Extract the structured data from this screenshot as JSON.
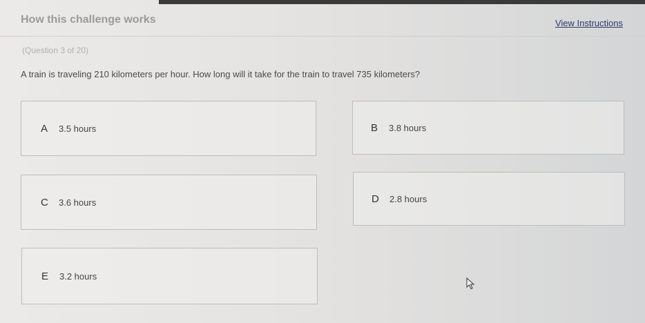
{
  "header": {
    "title": "How this challenge works",
    "view_instructions": "View Instructions"
  },
  "question": {
    "counter": "(Question 3 of 20)",
    "text": "A train is traveling 210 kilometers per hour. How long will it take for the train to travel 735 kilometers?"
  },
  "options": [
    {
      "letter": "A",
      "text": "3.5 hours"
    },
    {
      "letter": "B",
      "text": "3.8 hours"
    },
    {
      "letter": "C",
      "text": "3.6 hours"
    },
    {
      "letter": "D",
      "text": "2.8 hours"
    },
    {
      "letter": "E",
      "text": "3.2 hours"
    }
  ],
  "icons": {
    "cursor": "mouse-pointer-icon"
  }
}
